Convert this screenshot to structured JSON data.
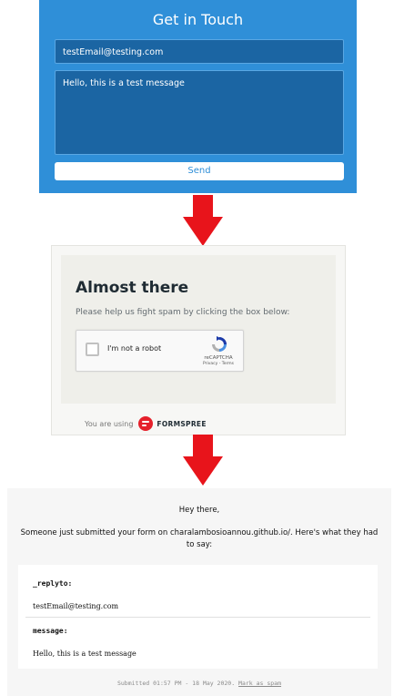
{
  "contact_form": {
    "title": "Get in Touch",
    "email_value": "testEmail@testing.com",
    "message_value": "Hello, this is a test message",
    "send_label": "Send"
  },
  "captcha_page": {
    "heading": "Almost there",
    "instructions": "Please help us fight spam by clicking the box below:",
    "checkbox_label": "I'm not a robot",
    "recaptcha_brand": "reCAPTCHA",
    "recaptcha_links": "Privacy - Terms",
    "powered_by_prefix": "You are using",
    "powered_by_brand": "FORMSPREE"
  },
  "email": {
    "greeting": "Hey there,",
    "intro": "Someone just submitted your form on charalambosioannou.github.io/. Here's what they had to say:",
    "fields": [
      {
        "label": "_replyto:",
        "value": "testEmail@testing.com"
      },
      {
        "label": "message:",
        "value": "Hello, this is a test message"
      }
    ],
    "submitted_text": "Submitted 01:57 PM - 18 May 2020.",
    "spam_link": "Mark as spam"
  },
  "colors": {
    "form_background": "#2f8fd8",
    "field_background": "#1b65a3",
    "arrow": "#e8141b",
    "formspree_red": "#e5202b"
  }
}
